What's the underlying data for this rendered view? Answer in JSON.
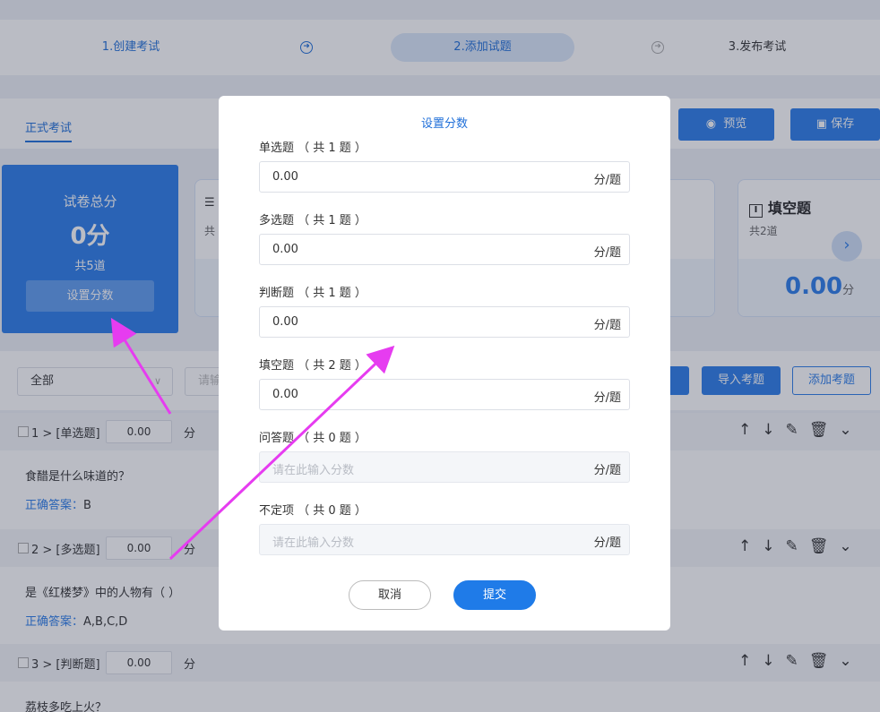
{
  "steps": {
    "step1": "1.创建考试",
    "step2": "2.添加试题",
    "step3": "3.发布考试"
  },
  "tabs": {
    "formal": "正式考试"
  },
  "toolbar": {
    "preview": "预览",
    "save": "保存"
  },
  "total_card": {
    "title": "试卷总分",
    "score": "0分",
    "count": "共5道",
    "set_button": "设置分数"
  },
  "type_card_partial": {
    "title": "",
    "count": "共"
  },
  "fill_card": {
    "title": "填空题",
    "count": "共2道",
    "score": "0.00",
    "unit": "分"
  },
  "filters": {
    "select_value": "全部",
    "search_placeholder": "请输",
    "import_button": "导入考题",
    "add_button": "添加考题"
  },
  "questions": [
    {
      "title": "1 > [单选题]",
      "score": "0.00",
      "unit": "分",
      "text": "食醋是什么味道的？",
      "answer_label": "正确答案：",
      "answer": "B"
    },
    {
      "title": "2 > [多选题]",
      "score": "0.00",
      "unit": "分",
      "text": "是《红楼梦》中的人物有（  ）",
      "answer_label": "正确答案：",
      "answer": "A,B,C,D"
    },
    {
      "title": "3 > [判断题]",
      "score": "0.00",
      "unit": "分",
      "text": "荔枝多吃上火？"
    }
  ],
  "modal": {
    "title": "设置分数",
    "rows": [
      {
        "label": "单选题 （ 共 1 题 ）",
        "value": "0.00",
        "unit": "分/题",
        "disabled": false
      },
      {
        "label": "多选题 （ 共 1 题 ）",
        "value": "0.00",
        "unit": "分/题",
        "disabled": false
      },
      {
        "label": "判断题 （ 共 1 题 ）",
        "value": "0.00",
        "unit": "分/题",
        "disabled": false
      },
      {
        "label": "填空题 （ 共 2 题 ）",
        "value": "0.00",
        "unit": "分/题",
        "disabled": false
      },
      {
        "label": "问答题 （ 共 0 题 ）",
        "placeholder": "请在此输入分数",
        "unit": "分/题",
        "disabled": true
      },
      {
        "label": "不定项 （ 共 0 题 ）",
        "placeholder": "请在此输入分数",
        "unit": "分/题",
        "disabled": true
      }
    ],
    "cancel": "取消",
    "submit": "提交"
  },
  "colors": {
    "accent": "#2b7de9",
    "annotation_arrow": "#e63cf0"
  },
  "icons": {
    "step_arrow": "arrow-right-circle-icon",
    "preview": "eye-icon",
    "save": "floppy-icon",
    "next": "chevron-right-icon",
    "tools": [
      "arrow-up-icon",
      "arrow-down-icon",
      "edit-icon",
      "trash-icon",
      "double-chevron-down-icon"
    ]
  }
}
